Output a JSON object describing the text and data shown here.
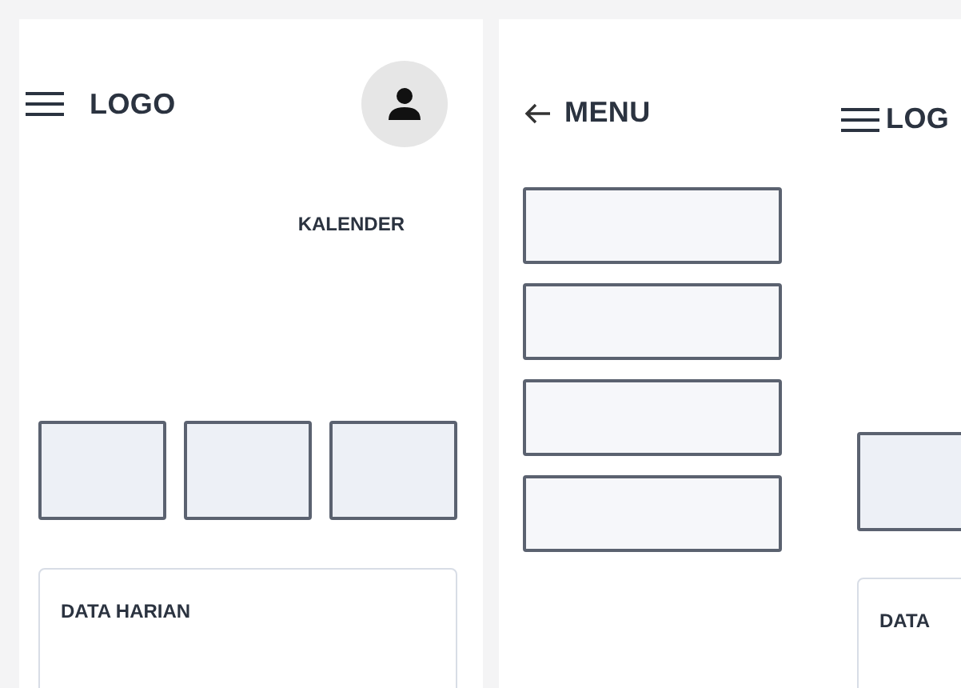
{
  "home": {
    "logo": "LOGO",
    "calendar_title": "KALENDER",
    "tiles": [
      {
        "kind": "placeholder"
      },
      {
        "kind": "placeholder"
      },
      {
        "kind": "placeholder"
      }
    ],
    "card_title": "DATA HARIAN"
  },
  "drawer": {
    "title": "MENU",
    "items": [
      {
        "kind": "placeholder"
      },
      {
        "kind": "placeholder"
      },
      {
        "kind": "placeholder"
      },
      {
        "kind": "placeholder"
      }
    ]
  },
  "behind": {
    "logo": "LOG",
    "tiles": [
      {
        "kind": "placeholder"
      }
    ],
    "card_title": "DATA"
  }
}
